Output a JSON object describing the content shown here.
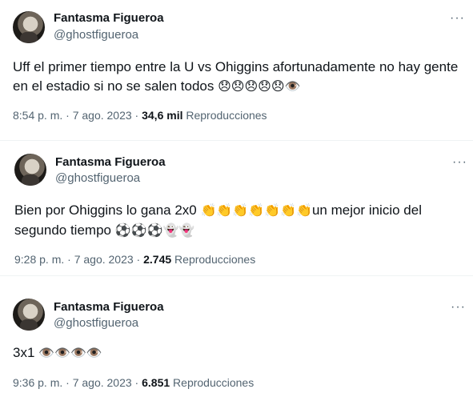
{
  "tweets": [
    {
      "author": "Fantasma Figueroa",
      "handle": "@ghostfigueroa",
      "more": "···",
      "text": "Uff el primer tiempo entre la U vs Ohiggins afortunadamente no hay gente en el estadio si no se salen todos",
      "emojis": "😞😞😞😞😞👁️",
      "time": "8:54 p. m. · 7 ago. 2023 · ",
      "views": "34,6 mil",
      "views_label": " Reproducciones"
    },
    {
      "author": "Fantasma Figueroa",
      "handle": "@ghostfigueroa",
      "more": "···",
      "text_a": "Bien por Ohiggins lo gana 2x0 ",
      "clap": "👏👏👏👏👏👏👏",
      "text_b": "un mejor inicio del",
      "text_c": "segundo tiempo ",
      "emojis_b": "⚽⚽⚽👻👻",
      "time": "9:28 p. m. · 7 ago. 2023 · ",
      "views": "2.745",
      "views_label": " Reproducciones"
    },
    {
      "author": "Fantasma Figueroa",
      "handle": "@ghostfigueroa",
      "more": "···",
      "text": "3x1 ",
      "emojis": "👁️👁️👁️👁️",
      "time": "9:36 p. m. · 7 ago. 2023 · ",
      "views": "6.851",
      "views_label": " Reproducciones"
    }
  ]
}
